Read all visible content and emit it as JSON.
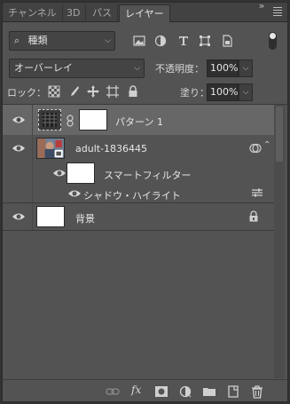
{
  "tabs": [
    {
      "label": "チャンネル"
    },
    {
      "label": "3D"
    },
    {
      "label": "パス"
    },
    {
      "label": "レイヤー"
    }
  ],
  "filter": {
    "kind_label": "種類"
  },
  "blend": {
    "mode": "オーバーレイ",
    "opacity_label": "不透明度：",
    "opacity_value": "100%"
  },
  "lock": {
    "label": "ロック：",
    "fill_label": "塗り：",
    "fill_value": "100%"
  },
  "layers": [
    {
      "name": "パターン 1"
    },
    {
      "name": "adult-1836445"
    },
    {
      "name": "スマートフィルター"
    },
    {
      "name": "シャドウ・ハイライト"
    },
    {
      "name": "背景"
    }
  ],
  "colors": {
    "panel_bg": "#535353",
    "selected_row": "#676767",
    "text": "#e6e6e6"
  }
}
